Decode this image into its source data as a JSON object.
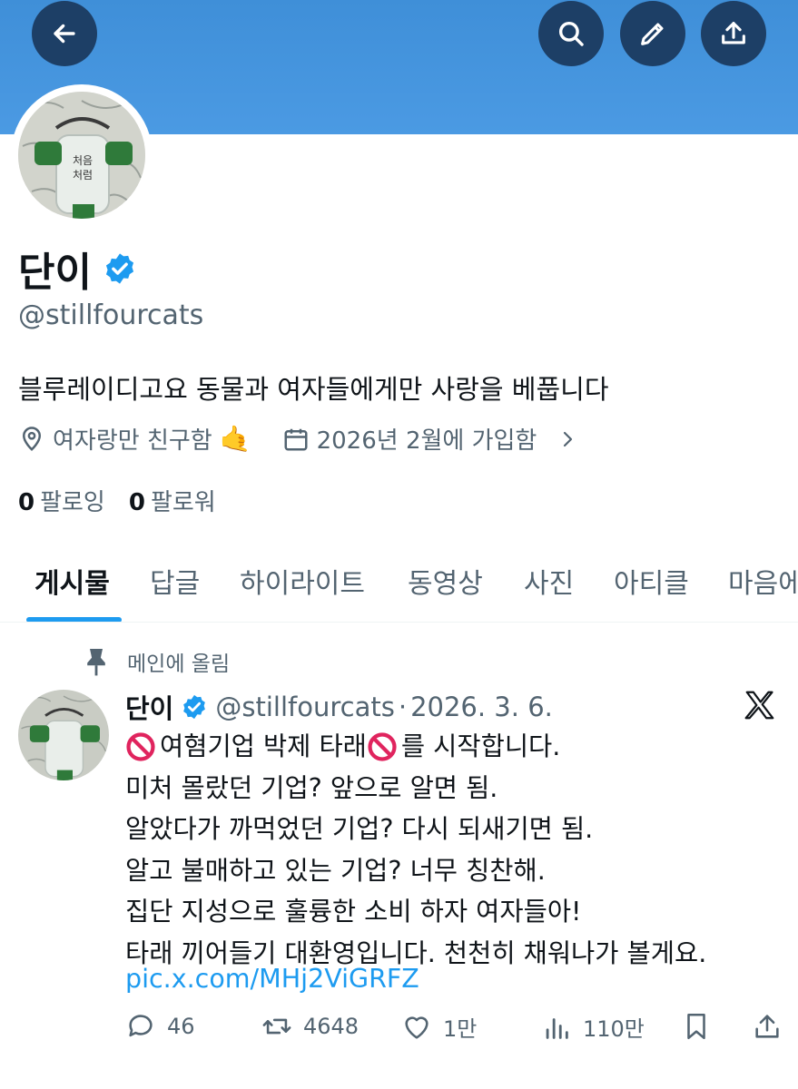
{
  "header": {
    "back_icon": "arrow-left-icon",
    "search_icon": "search-icon",
    "edit_icon": "pencil-icon",
    "share_icon": "share-icon",
    "banner_color": "#4b9ae3"
  },
  "profile": {
    "name": "단이",
    "verified": true,
    "handle": "@stillfourcats",
    "bio": "블루레이디고요 동물과 여자들에게만 사랑을 베풉니다",
    "location": "여자랑만 친구함",
    "location_emoji": "🤙",
    "joined": "2026년 2월에 가입함",
    "following_count": "0",
    "following_label": "팔로잉",
    "followers_count": "0",
    "followers_label": "팔로워"
  },
  "tabs": [
    {
      "label": "게시물",
      "active": true
    },
    {
      "label": "답글"
    },
    {
      "label": "하이라이트"
    },
    {
      "label": "동영상"
    },
    {
      "label": "사진"
    },
    {
      "label": "아티클"
    },
    {
      "label": "마음에"
    }
  ],
  "post": {
    "pinned_label": "메인에 올림",
    "name": "단이",
    "handle": "@stillfourcats",
    "separator": "·",
    "date": "2026. 3. 6.",
    "lines": [
      "여혐기업 박제 타래",
      "를 시작합니다.",
      "미처 몰랐던 기업? 앞으로 알면 됨.",
      "알았다가 까먹었던 기업? 다시 되새기면 됨.",
      "알고 불매하고 있는 기업? 너무 칭찬해.",
      "집단 지성으로 훌륭한 소비 하자 여자들아!",
      "타래 끼어들기 대환영입니다. 천천히 채워나가 볼게요."
    ],
    "link": "pic.x.com/MHj2ViGRFZ",
    "stats": {
      "replies": "46",
      "reposts": "4648",
      "likes": "1만",
      "views": "110만"
    }
  },
  "colors": {
    "accent": "#1d9bf0",
    "text_primary": "#0f1419",
    "text_secondary": "#536471"
  }
}
